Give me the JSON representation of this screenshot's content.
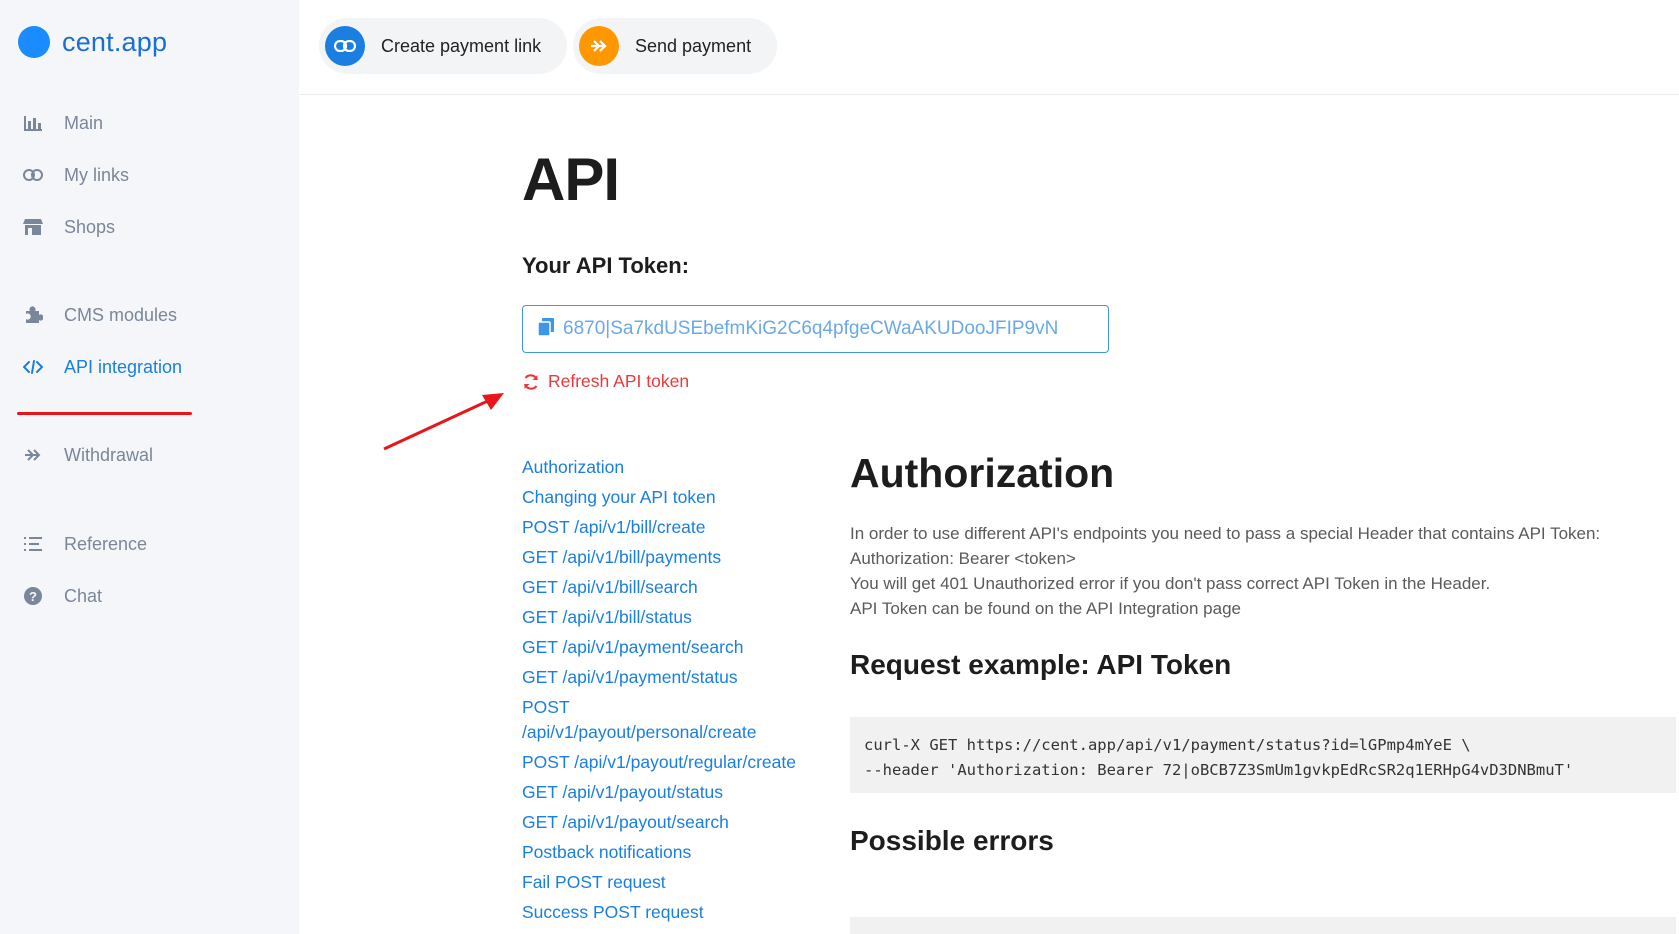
{
  "brand": {
    "name": "cent.app",
    "color": "#1a8cff"
  },
  "sidebar": {
    "items": [
      {
        "label": "Main",
        "icon": "bar-chart-icon"
      },
      {
        "label": "My links",
        "icon": "link-icon"
      },
      {
        "label": "Shops",
        "icon": "store-icon"
      },
      {
        "label": "CMS modules",
        "icon": "puzzle-icon"
      },
      {
        "label": "API integration",
        "icon": "code-icon",
        "active": true
      },
      {
        "label": "Withdrawal",
        "icon": "double-arrow-icon"
      },
      {
        "label": "Reference",
        "icon": "list-icon"
      },
      {
        "label": "Chat",
        "icon": "help-circle-icon"
      }
    ]
  },
  "topbar": {
    "create_link_label": "Create payment link",
    "send_payment_label": "Send payment"
  },
  "page": {
    "title": "API",
    "token_label": "Your API Token:",
    "token_value": "6870|Sa7kdUSEbefmKiG2C6q4pfgeCWaAKUDooJFIP9vN",
    "refresh_label": "Refresh API token"
  },
  "toc": [
    "Authorization",
    "Changing your API token",
    "POST /api/v1/bill/create",
    "GET /api/v1/bill/payments",
    "GET /api/v1/bill/search",
    "GET /api/v1/bill/status",
    "GET /api/v1/payment/search",
    "GET /api/v1/payment/status",
    "POST\n/api/v1/payout/personal/create",
    "POST /api/v1/payout/regular/create",
    "GET /api/v1/payout/status",
    "GET /api/v1/payout/search",
    "Postback notifications",
    "Fail POST request",
    "Success POST request"
  ],
  "content": {
    "heading": "Authorization",
    "paragraph": [
      "In order to use different API's endpoints you need to pass a special Header that contains API Token:",
      "Authorization: Bearer <token>",
      "You will get 401 Unauthorized error if you don't pass correct API Token in the Header.",
      "API Token can be found on the API Integration page"
    ],
    "request_heading": "Request example: API Token",
    "code_lines": [
      "curl-X GET https://cent.app/api/v1/payment/status?id=lGPmp4mYeE \\",
      "--header 'Authorization: Bearer 72|oBCB7Z3SmUm1gvkpEdRcSR2q1ERHpG4vD3DNBmuT'"
    ],
    "errors_heading": "Possible errors"
  },
  "colors": {
    "accent": "#1a7fe0",
    "danger": "#e83a3a",
    "orange": "#ff9800",
    "sidebar_bg": "#f4f6fa"
  }
}
